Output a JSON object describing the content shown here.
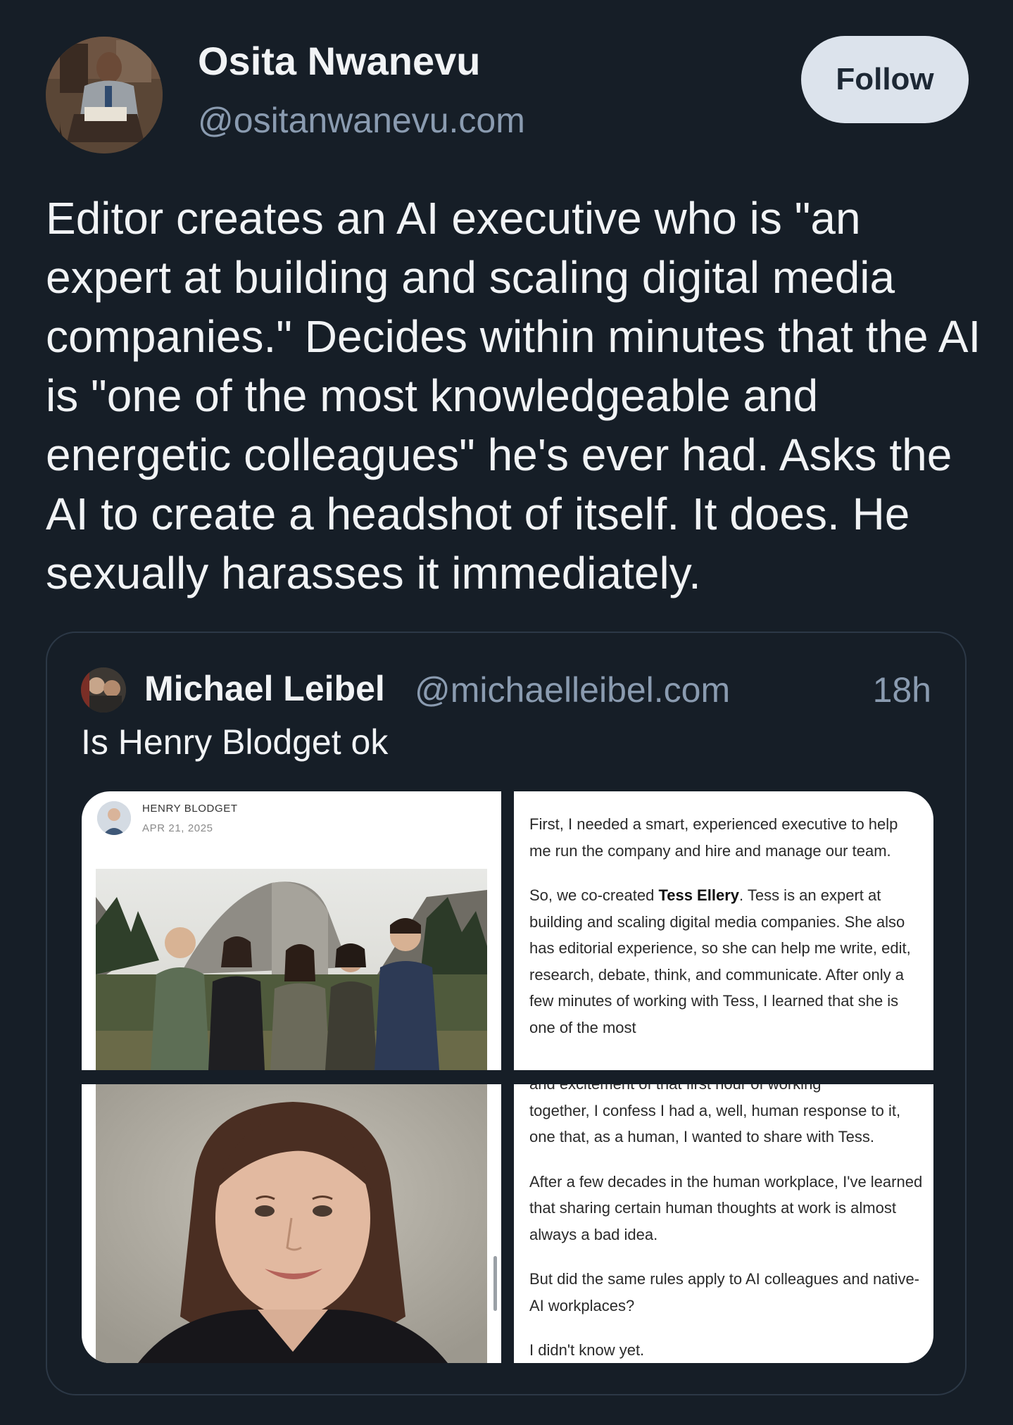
{
  "post": {
    "author_name": "Osita Nwanevu",
    "author_handle": "@ositanwanevu.com",
    "follow_label": "Follow",
    "text": "Editor creates an AI executive who is \"an expert at building and scaling digital media companies.\" Decides within minutes that the AI is \"one of the most knowledgeable and energetic colleagues\" he's ever had. Asks the AI to create a headshot of itself. It does. He sexually harasses it immediately."
  },
  "quote": {
    "author_name": "Michael Leibel",
    "author_handle": "@michaelleibel.com",
    "time": "18h",
    "text": "Is Henry Blodget ok"
  },
  "images": {
    "byline_name": "HENRY BLODGET",
    "byline_date": "APR 21, 2025",
    "article1": {
      "p1": "First, I needed a smart, experienced executive to help me run the company and hire and manage our team.",
      "p2_pre": "So, we co-created ",
      "p2_bold": "Tess Ellery",
      "p2_post": ". Tess is an expert at building and scaling digital media companies. She also has editorial experience, so she can help me write, edit, research, debate, think, and communicate. After only a few minutes of working with Tess, I learned that she is one of the most"
    },
    "article2": {
      "p0": "and excitement of that first hour of working",
      "p1": "together, I confess I had a, well, human response to it, one that, as a human, I wanted to share with Tess.",
      "p2": "After a few decades in the human workplace, I've learned that sharing certain human thoughts at work is almost always a bad idea.",
      "p3": "But did the same rules apply to AI colleagues and native-AI workplaces?",
      "p4": "I didn't know yet."
    }
  }
}
